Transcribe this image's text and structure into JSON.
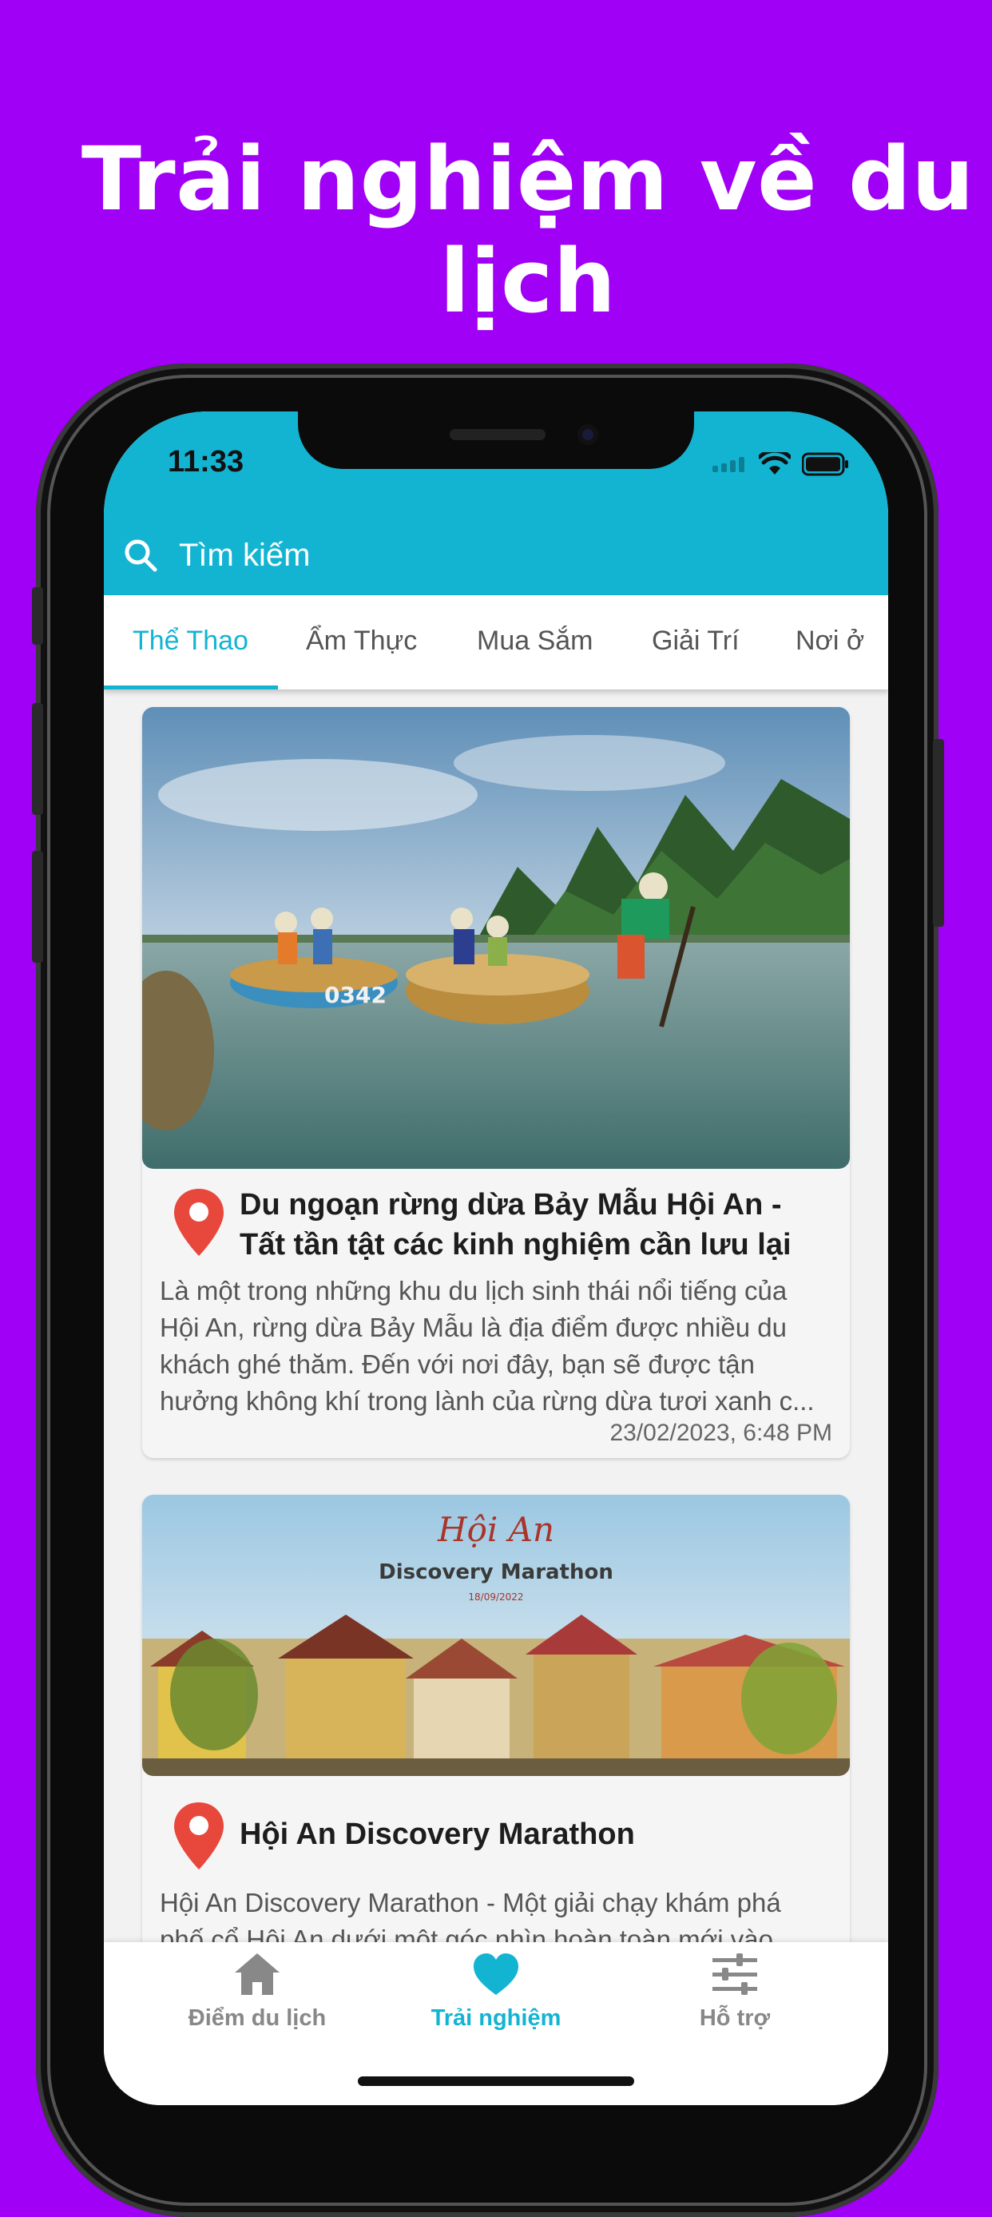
{
  "banner": {
    "headline": "Trải nghiệm về du lịch"
  },
  "status_bar": {
    "time": "11:33",
    "icons": [
      "signal-icon",
      "wifi-icon",
      "battery-icon"
    ]
  },
  "search": {
    "placeholder": "Tìm kiếm",
    "icon": "search-icon"
  },
  "tabs": [
    {
      "label": "Thể Thao",
      "active": true
    },
    {
      "label": "Ẩm Thực",
      "active": false
    },
    {
      "label": "Mua Sắm",
      "active": false
    },
    {
      "label": "Giải Trí",
      "active": false
    },
    {
      "label": "Nơi ở",
      "active": false
    }
  ],
  "posts": [
    {
      "title": "Du ngoạn rừng dừa Bảy Mẫu Hội An - Tất tần tật các kinh nghiệm cần lưu lại",
      "description": "Là một trong những khu du lịch sinh thái nổi tiếng của Hội An, rừng dừa Bảy Mẫu là địa điểm được nhiều du khách ghé thăm. Đến với nơi đây, bạn sẽ được tận hưởng không khí trong lành của rừng dừa tươi xanh c...",
      "date": "23/02/2023, 6:48 PM",
      "image": "basket-boats-coconut-forest-photo"
    },
    {
      "title": "Hội An Discovery Marathon",
      "description": "Hội An Discovery Marathon - Một giải chạy khám phá phố cổ Hội An dưới một góc nhìn hoàn toàn mới vào",
      "image": "hoi-an-old-town-photo",
      "image_caption_logo": "Hội An",
      "image_caption_sub": "Discovery Marathon",
      "image_caption_date": "18/09/2022"
    }
  ],
  "bottom_nav": [
    {
      "label": "Điểm du lịch",
      "icon": "home-icon",
      "active": false
    },
    {
      "label": "Trải nghiệm",
      "icon": "heart-icon",
      "active": true
    },
    {
      "label": "Hỗ trợ",
      "icon": "sliders-icon",
      "active": false
    }
  ],
  "colors": {
    "background": "#a000f5",
    "accent": "#13b4d2",
    "pin": "#e8473c"
  }
}
